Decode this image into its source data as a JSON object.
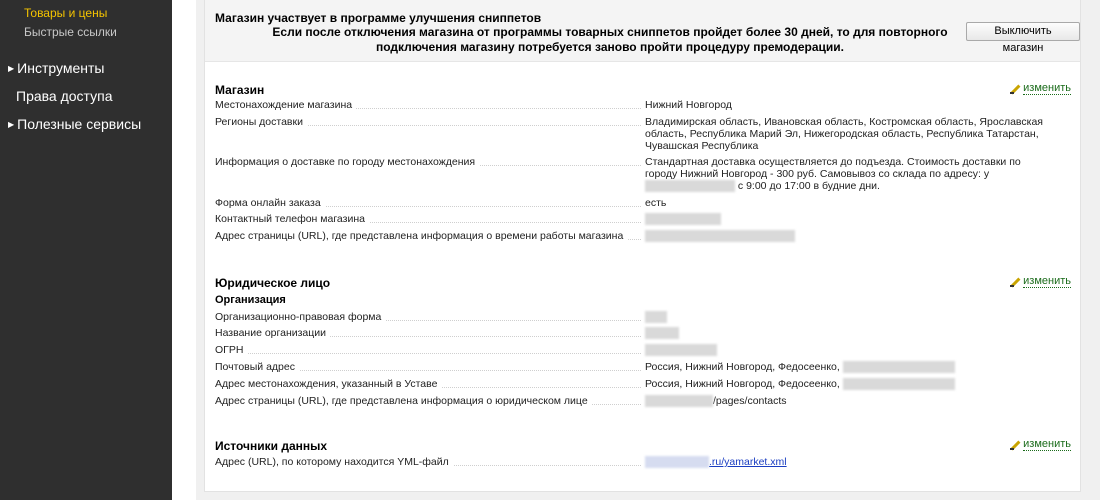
{
  "sidebar": {
    "sub_items": [
      {
        "label": "Товары и цены",
        "color": "#f5c400"
      },
      {
        "label": "Быстрые ссылки",
        "color": "#c8c8c8"
      }
    ],
    "main_items": [
      {
        "label": "Инструменты",
        "expandable": true
      },
      {
        "label": "Права доступа",
        "expandable": false
      },
      {
        "label": "Полезные сервисы",
        "expandable": true
      }
    ]
  },
  "notice": {
    "title": "Магазин участвует в программе улучшения сниппетов",
    "text": "Если после отключения магазина от программы товарных сниппетов пройдет более 30 дней, то для повторного подключения магазину потребуется заново пройти процедуру премодерации.",
    "button_label": "Выключить магазин"
  },
  "edit_label": "изменить",
  "shop": {
    "title": "Магазин",
    "rows": [
      {
        "key": "Местонахождение магазина",
        "value": "Нижний Новгород"
      },
      {
        "key": "Регионы доставки",
        "value": "Владимирская область, Ивановская область, Костромская область, Ярославская область, Республика Марий Эл, Нижегородская область, Республика Татарстан, Чувашская Республика"
      },
      {
        "key": "Информация о доставке по городу местонахождения",
        "value_a": "Стандартная доставка осуществляется до подъезда. Стоимость доставки по городу Нижний Новгород - 300 руб. Самовывоз со склада по адресу: у",
        "value_b": "с 9:00 до 17:00 в будние дни."
      },
      {
        "key": "Форма онлайн заказа",
        "value": "есть"
      },
      {
        "key": "Контактный телефон магазина",
        "value": ""
      },
      {
        "key": "Адрес страницы (URL), где представлена информация о времени работы магазина",
        "value": ""
      }
    ]
  },
  "legal": {
    "title": "Юридическое лицо",
    "subhead": "Организация",
    "rows": [
      {
        "key": "Организационно-правовая форма",
        "value": ""
      },
      {
        "key": "Название организации",
        "value": ""
      },
      {
        "key": "ОГРН",
        "value": ""
      },
      {
        "key": "Почтовый адрес",
        "value": "Россия, Нижний Новгород, Федосеенко,"
      },
      {
        "key": "Адрес местонахождения, указанный в Уставе",
        "value": "Россия, Нижний Новгород, Федосеенко,"
      },
      {
        "key": "Адрес страницы (URL), где представлена информация о юридическом лице",
        "value": "/pages/contacts"
      }
    ]
  },
  "sources": {
    "title": "Источники данных",
    "rows": [
      {
        "key": "Адрес (URL), по которому находится YML-файл",
        "value": ".ru/yamarket.xml"
      }
    ]
  },
  "colors": {
    "sidebar_bg": "#2f2f2f",
    "active_item": "#f5c400",
    "edit_link": "#1a6b1a",
    "url_link": "#1a3dc1"
  }
}
